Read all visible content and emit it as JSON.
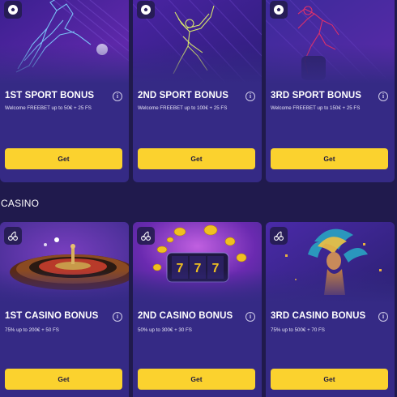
{
  "sport": {
    "cards": [
      {
        "title": "1ST SPORT BONUS",
        "description": "Welcome FREEBET up to 50€ + 25 FS",
        "button": "Get",
        "category_icon": "football-icon",
        "info_icon": "i"
      },
      {
        "title": "2ND SPORT BONUS",
        "description": "Welcome FREEBET up to 100€ + 25 FS",
        "button": "Get",
        "category_icon": "football-icon",
        "info_icon": "i"
      },
      {
        "title": "3RD SPORT BONUS",
        "description": "Welcome FREEBET up to 150€ + 25 FS",
        "button": "Get",
        "category_icon": "football-icon",
        "info_icon": "i"
      }
    ]
  },
  "casino": {
    "heading": "CASINO",
    "cards": [
      {
        "title": "1ST CASINO BONUS",
        "description": "75% up to 200€ + 50 FS",
        "button": "Get",
        "category_icon": "cherries-icon",
        "info_icon": "i"
      },
      {
        "title": "2ND CASINO BONUS",
        "description": "50% up to 300€ + 30 FS",
        "button": "Get",
        "category_icon": "cherries-icon",
        "info_icon": "i"
      },
      {
        "title": "3RD CASINO BONUS",
        "description": "75% up to 500€ + 70 FS",
        "button": "Get",
        "category_icon": "cherries-icon",
        "info_icon": "i"
      }
    ]
  },
  "colors": {
    "page_background": "#201a4d",
    "card_background": "#352a85",
    "button": "#fbd22e",
    "button_text": "#1f1a3d"
  }
}
